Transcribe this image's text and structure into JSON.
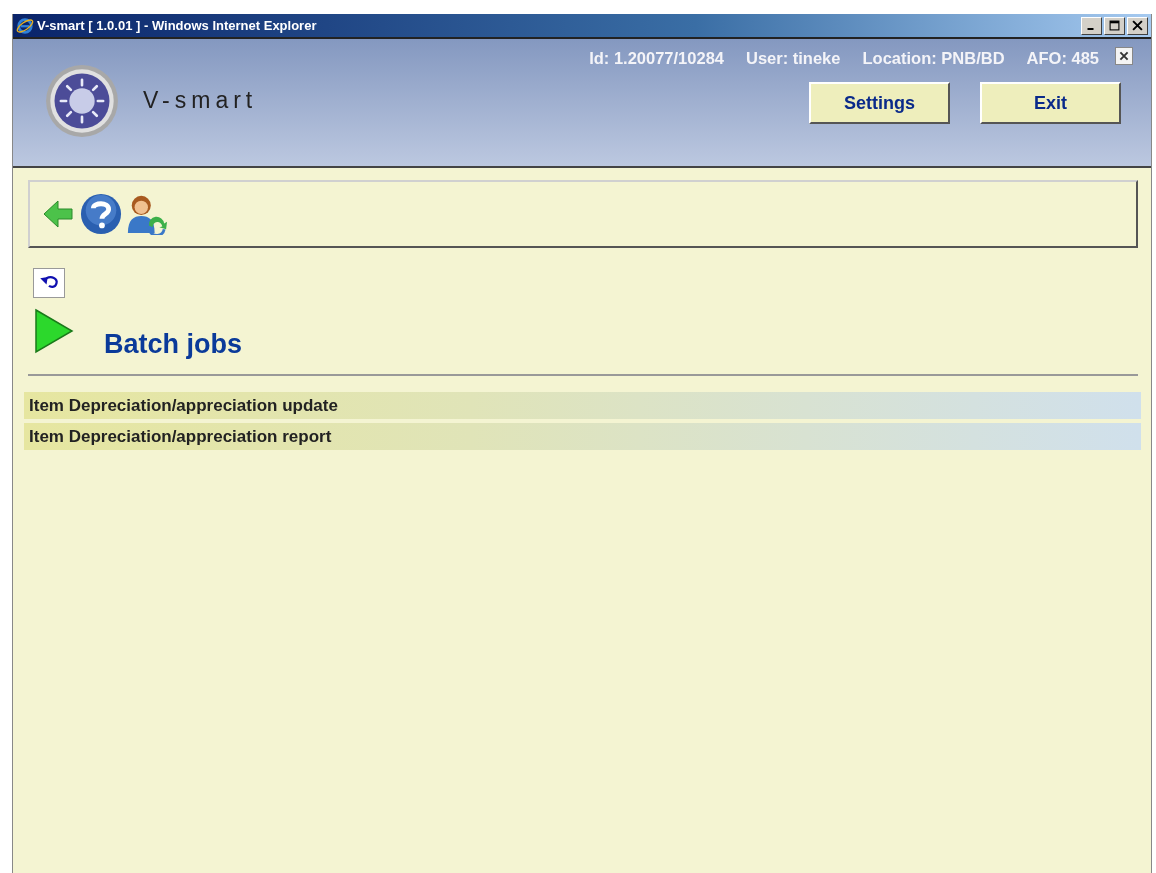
{
  "window": {
    "title": "V-smart [ 1.0.01 ] - Windows Internet Explorer"
  },
  "header": {
    "logo_text": "V-smart",
    "info": [
      "Id: 1.20077/10284",
      "User: tineke",
      "Location: PNB/BD",
      "AFO: 485"
    ],
    "buttons": [
      "Settings",
      "Exit"
    ]
  },
  "page": {
    "heading": "Batch jobs",
    "items": [
      "Item Depreciation/appreciation update",
      "Item Depreciation/appreciation report"
    ]
  }
}
